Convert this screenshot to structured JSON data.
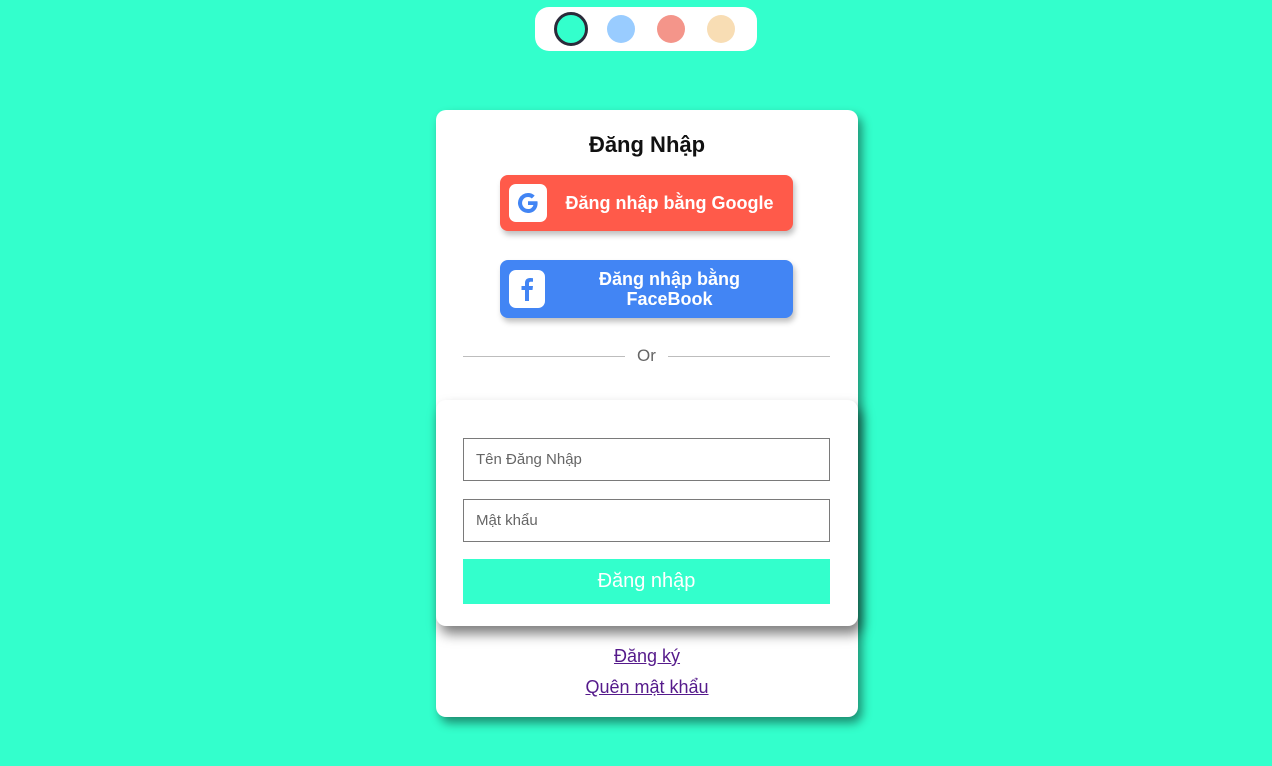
{
  "theme_swatches": [
    {
      "name": "mint",
      "color": "#33ffcc",
      "active": true
    },
    {
      "name": "light-blue",
      "color": "#99ccff",
      "active": false
    },
    {
      "name": "salmon",
      "color": "#f4958a",
      "active": false
    },
    {
      "name": "peach",
      "color": "#f8ddb4",
      "active": false
    }
  ],
  "login": {
    "title": "Đăng Nhập",
    "google_button": {
      "label": "Đăng nhập bằng Google",
      "icon": "google-icon",
      "color": "#ff5a4a"
    },
    "facebook_button": {
      "label": "Đăng nhập bằng FaceBook",
      "icon": "facebook-icon",
      "color": "#4285f4"
    },
    "divider_text": "Or",
    "username": {
      "placeholder": "Tên Đăng Nhập",
      "value": ""
    },
    "password": {
      "placeholder": "Mật khẩu",
      "value": ""
    },
    "submit_label": "Đăng nhập",
    "register_link": "Đăng ký",
    "forgot_link": "Quên mật khẩu"
  },
  "colors": {
    "background": "#33ffcc",
    "accent": "#33ffcc",
    "link": "#551a8b"
  }
}
